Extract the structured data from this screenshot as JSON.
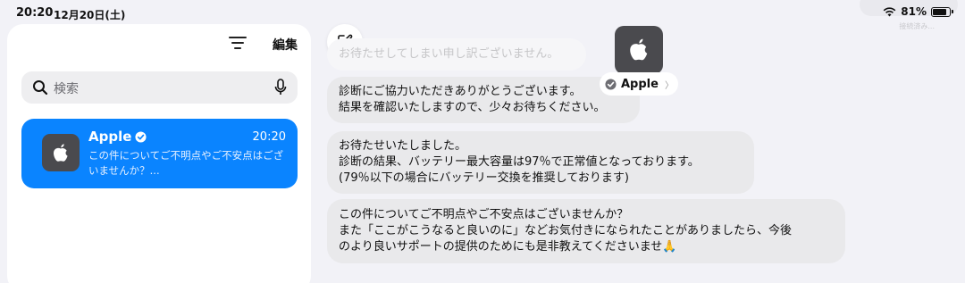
{
  "status": {
    "time": "20:20",
    "date": "12月20日(土)",
    "battery": "81%",
    "battery_level": 0.81,
    "ghost": "接続済み..."
  },
  "sidebar": {
    "edit_label": "編集",
    "search_placeholder": "検索",
    "conversation": {
      "name": "Apple",
      "time": "20:20",
      "preview": "この件についてご不明点やご不安点はございませんか？..."
    }
  },
  "chat": {
    "contact_name": "Apple",
    "messages": [
      {
        "lines": [
          "お待たせしてしまい申し訳ございません。"
        ]
      },
      {
        "lines": [
          "診断にご協力いただきありがとうございます。",
          "結果を確認いたしますので、少々お待ちください。"
        ]
      },
      {
        "lines": [
          "お待たせいたしました。",
          "診断の結果、バッテリー最大容量は97％で正常値となっております。",
          "(79％以下の場合にバッテリー交換を推奨しております)"
        ]
      },
      {
        "lines": [
          "この件についてご不明点やご不安点はございませんか？",
          "また「ここがこうなると良いのに」などお気付きになられたことがありましたら、今後",
          "のより良いサポートの提供のためにも是非教えてくださいませ🙏"
        ]
      }
    ]
  },
  "colors": {
    "accent": "#0a84ff",
    "bubble": "#e9e9eb",
    "background": "#f2f2f7"
  }
}
